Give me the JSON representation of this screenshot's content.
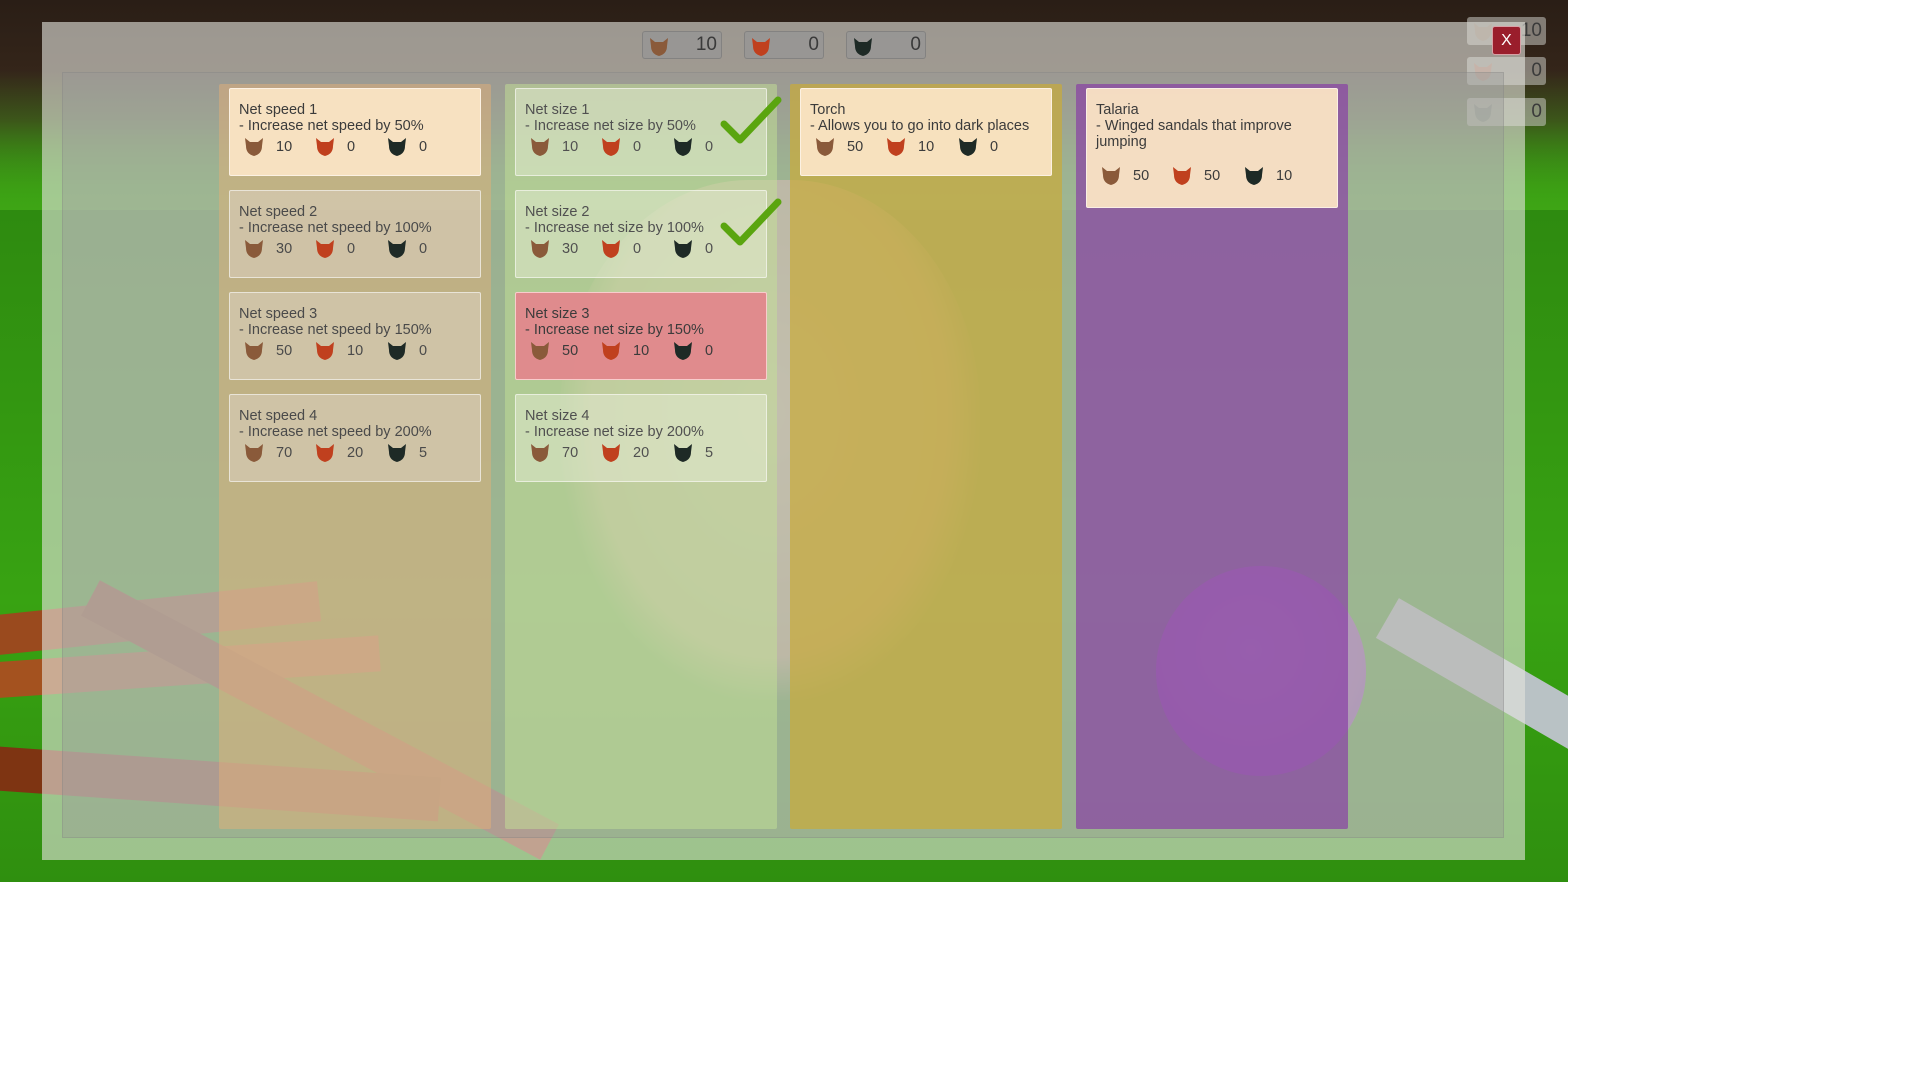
{
  "resources": {
    "brown": {
      "icon": "brown-critter-icon",
      "count": "10",
      "color": "#8a5a3a"
    },
    "red": {
      "icon": "red-critter-icon",
      "count": "0",
      "color": "#c0401e"
    },
    "dark": {
      "icon": "dark-critter-icon",
      "count": "0",
      "color": "#1e2a26"
    }
  },
  "mini_counters": [
    "10",
    "0",
    "0"
  ],
  "close_label": "X",
  "columns": [
    {
      "id": "speed",
      "color": "#e6af78",
      "items": [
        {
          "title": "Net speed 1",
          "desc": "- Increase net speed by 50%",
          "costs": [
            "10",
            "0",
            "0"
          ],
          "state": "available"
        },
        {
          "title": "Net speed 2",
          "desc": "- Increase net speed by 100%",
          "costs": [
            "30",
            "0",
            "0"
          ],
          "state": "locked"
        },
        {
          "title": "Net speed 3",
          "desc": "- Increase net speed by 150%",
          "costs": [
            "50",
            "10",
            "0"
          ],
          "state": "locked"
        },
        {
          "title": "Net speed 4",
          "desc": "- Increase net speed by 200%",
          "costs": [
            "70",
            "20",
            "5"
          ],
          "state": "locked"
        }
      ]
    },
    {
      "id": "size",
      "color": "#c3e196",
      "items": [
        {
          "title": "Net size 1",
          "desc": "- Increase net size by 50%",
          "costs": [
            "10",
            "0",
            "0"
          ],
          "state": "owned",
          "purchased": true
        },
        {
          "title": "Net size 2",
          "desc": "- Increase net size by 100%",
          "costs": [
            "30",
            "0",
            "0"
          ],
          "state": "owned",
          "purchased": true
        },
        {
          "title": "Net size 3",
          "desc": "- Increase net size by 150%",
          "costs": [
            "50",
            "10",
            "0"
          ],
          "state": "unaffordable"
        },
        {
          "title": "Net size 4",
          "desc": "- Increase net size by 200%",
          "costs": [
            "70",
            "20",
            "5"
          ],
          "state": "owned"
        }
      ]
    },
    {
      "id": "misc",
      "color": "#c8aa3c",
      "items": [
        {
          "title": "Torch",
          "desc": "- Allows you to go into dark places",
          "costs": [
            "50",
            "10",
            "0"
          ],
          "state": "available"
        }
      ]
    },
    {
      "id": "gear",
      "color": "#873ca5",
      "items": [
        {
          "title": "Talaria",
          "desc": "- Winged sandals that improve jumping",
          "costs": [
            "50",
            "50",
            "10"
          ],
          "state": "available"
        }
      ]
    }
  ],
  "check_color": "#5aa50f"
}
